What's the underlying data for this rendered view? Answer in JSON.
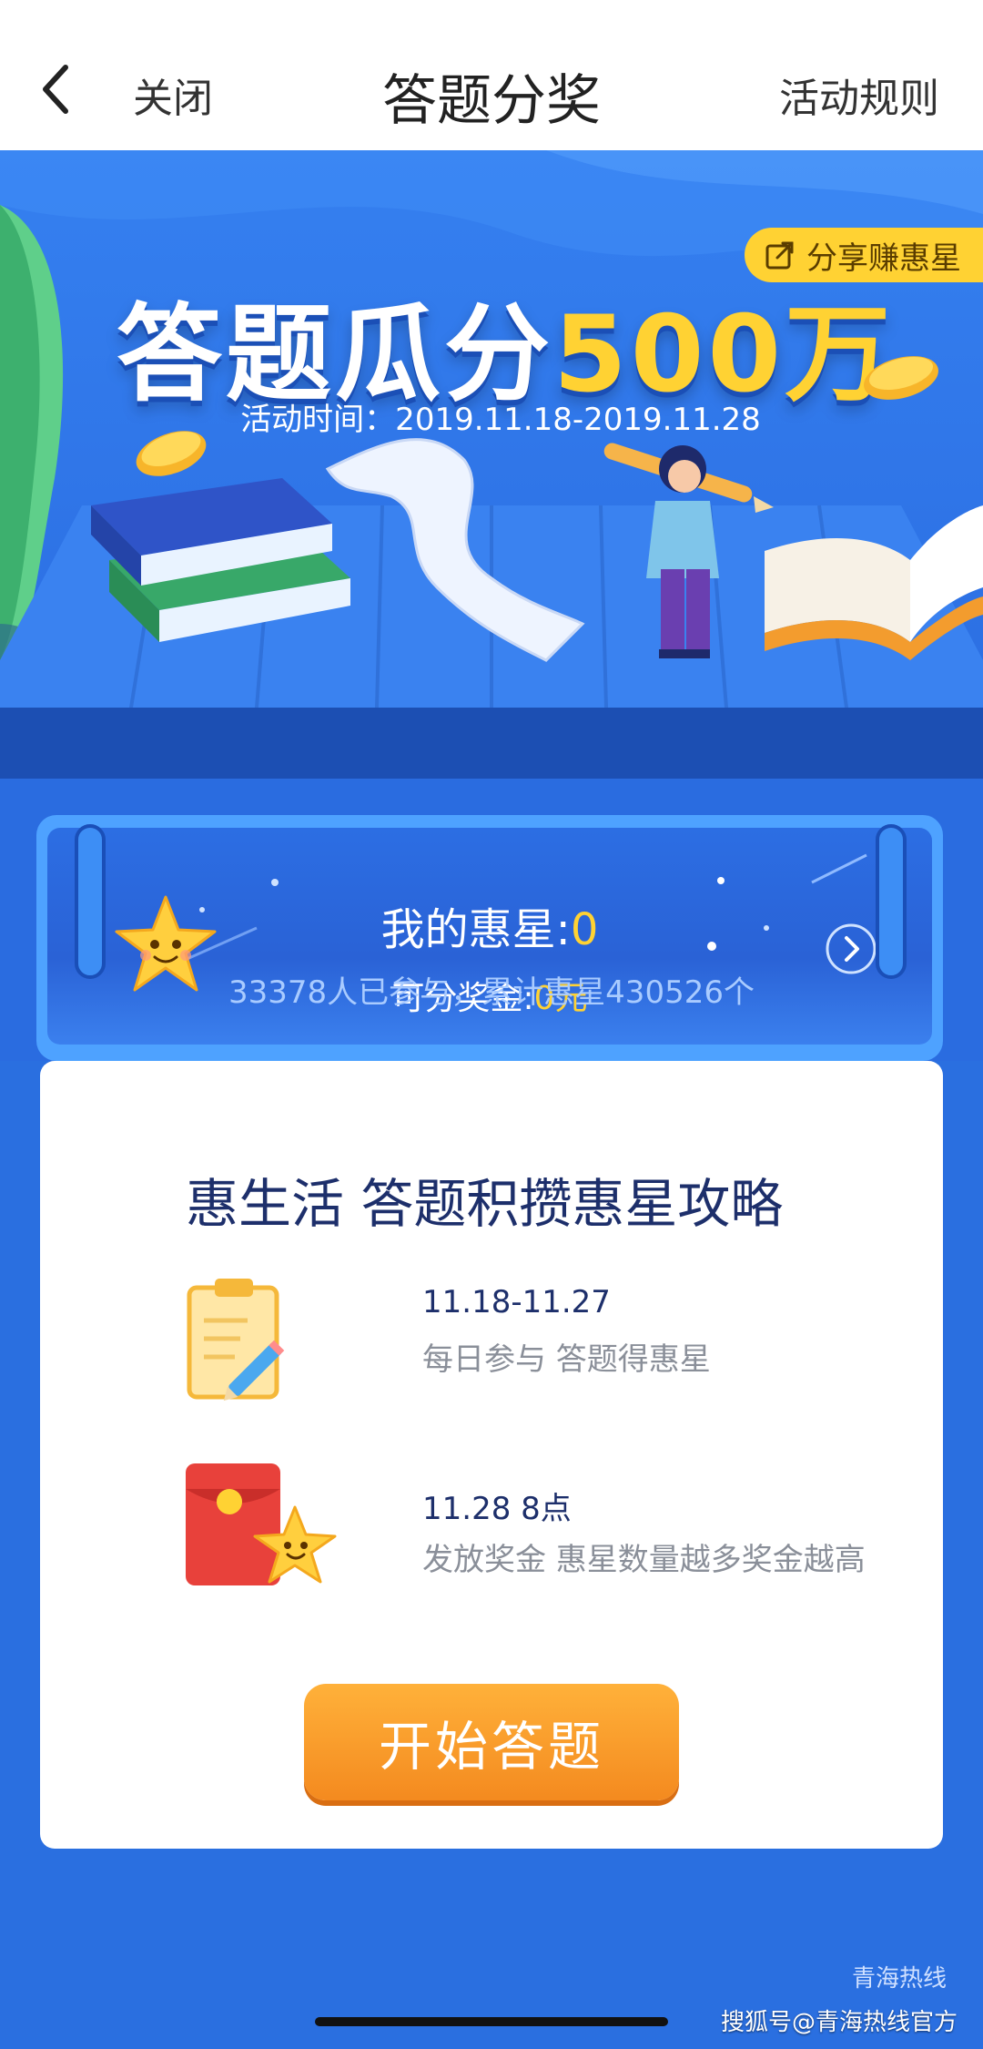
{
  "navbar": {
    "close_label": "关闭",
    "title": "答题分奖",
    "rules_label": "活动规则",
    "back_icon": "chevron-left-icon"
  },
  "hero": {
    "share_label": "分享赚惠星",
    "share_icon": "share-icon",
    "title_prefix": "答题瓜分",
    "title_amount": "500万",
    "date_text": "活动时间：2019.11.18-2019.11.28"
  },
  "star_card": {
    "my_stars_label": "我的惠星:",
    "my_stars_value": "0",
    "prize_label": "可分奖金:",
    "prize_value": "0元",
    "arrow_icon": "chevron-right-circle-icon"
  },
  "stats_text": "33378人已参与，累计惠星430526个",
  "strategy": {
    "title": "惠生活 答题积攒惠星攻略",
    "steps": [
      {
        "date": "11.18-11.27",
        "desc": "每日参与 答题得惠星",
        "icon": "clipboard-pencil-icon"
      },
      {
        "date": "11.28 8点",
        "desc": "发放奖金 惠星数量越多奖金越高",
        "icon": "red-envelope-star-icon"
      }
    ],
    "start_label": "开始答题"
  },
  "watermark": {
    "text": "搜狐号@青海热线官方",
    "logo_text": "青海热线"
  },
  "colors": {
    "brand_blue": "#2e73e6",
    "accent_yellow": "#ffd233",
    "button_orange": "#f48a1f",
    "title_navy": "#1d2f6b"
  }
}
